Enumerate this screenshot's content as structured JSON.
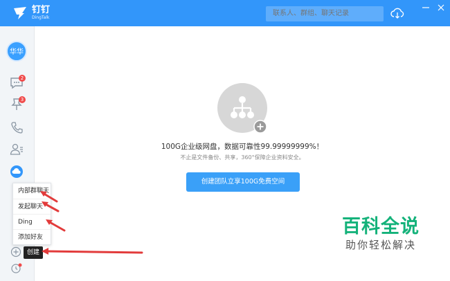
{
  "app": {
    "brand_cn": "钉钉",
    "brand_en": "DingTalk",
    "search_placeholder": "联系人、群组、聊天记录"
  },
  "colors": {
    "brand": "#3296fa",
    "button": "#3aa0f8",
    "badge": "#f04a4a",
    "annotation_arrow": "#e23b3b",
    "watermark": "#14b27a"
  },
  "sidebar": {
    "avatar_label": "华华",
    "items": [
      {
        "icon": "chat-bubble-icon",
        "badge": "2"
      },
      {
        "icon": "pin-icon",
        "badge": "3"
      },
      {
        "icon": "phone-icon",
        "badge": ""
      },
      {
        "icon": "contacts-icon",
        "badge": ""
      },
      {
        "icon": "cloud-disk-icon",
        "badge": ""
      }
    ]
  },
  "menu": {
    "items": [
      "内部群聊天",
      "发起聊天",
      "Ding",
      "添加好友"
    ]
  },
  "create_tooltip": "创建",
  "main": {
    "headline": "100G企业级网盘，数据可靠性99.99999999%！",
    "subline": "不止是文件备份、共享，360°保障企业资料安全。",
    "cta_label": "创建团队立享100G免费空间"
  },
  "watermark": {
    "title": "百科全说",
    "subtitle": "助你轻松解决"
  }
}
